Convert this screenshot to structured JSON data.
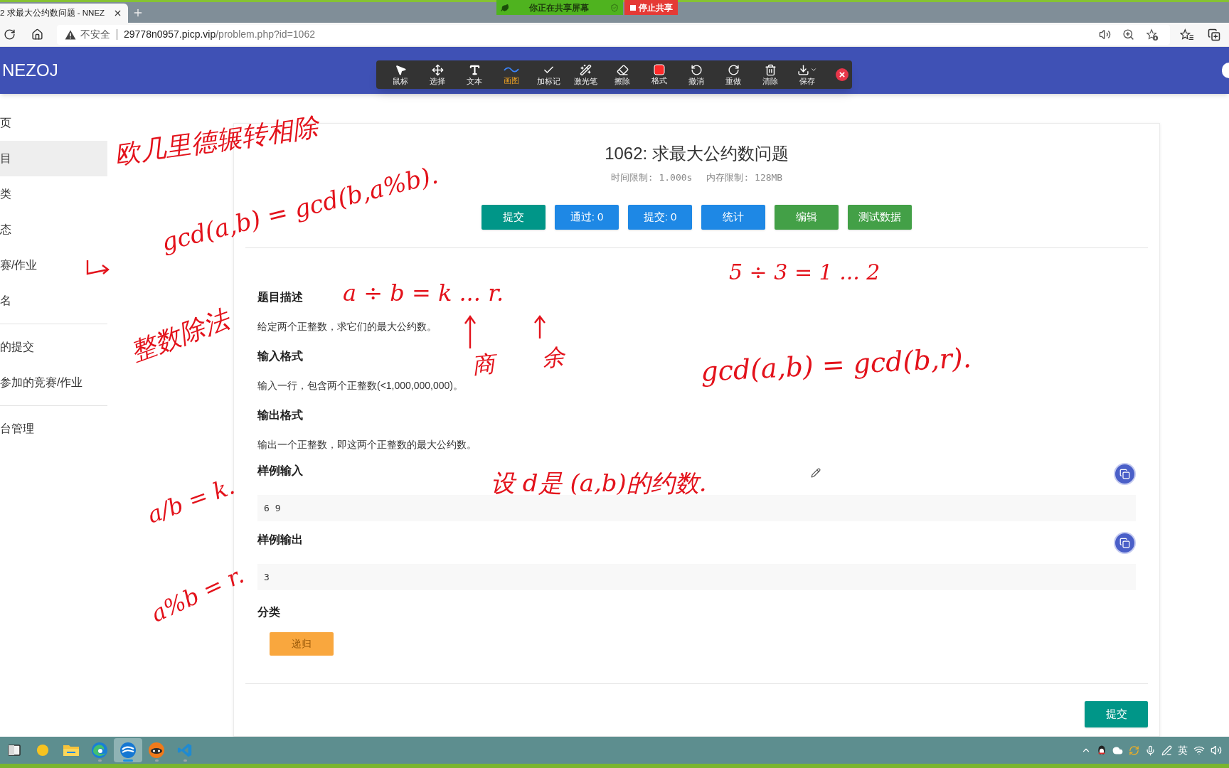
{
  "browser": {
    "tab_title": "2 求最大公约数问题 - NNEZ",
    "share_banner": {
      "status": "你正在共享屏幕",
      "stop": "停止共享"
    },
    "address": {
      "security": "不安全",
      "host": "29778n0957.picp.vip",
      "path": "/problem.php?id=1062"
    }
  },
  "navbar": {
    "brand": "NEZOJ"
  },
  "draw_toolbar": {
    "tools": [
      {
        "kind": "pointer",
        "label": "鼠标",
        "selected": false
      },
      {
        "kind": "move",
        "label": "选择",
        "selected": false
      },
      {
        "kind": "text",
        "label": "文本",
        "selected": false
      },
      {
        "kind": "pen",
        "label": "画图",
        "selected": true
      },
      {
        "kind": "mark",
        "label": "加标记",
        "selected": false
      },
      {
        "kind": "laser",
        "label": "激光笔",
        "selected": false
      },
      {
        "kind": "eraser",
        "label": "擦除",
        "selected": false
      },
      {
        "kind": "format",
        "label": "格式",
        "selected": false
      },
      {
        "kind": "undo",
        "label": "撤消",
        "selected": false
      },
      {
        "kind": "redo",
        "label": "重做",
        "selected": false
      },
      {
        "kind": "clear",
        "label": "清除",
        "selected": false
      },
      {
        "kind": "save",
        "label": "保存",
        "selected": false
      }
    ]
  },
  "sidebar": {
    "groups": [
      [
        {
          "label": "页",
          "selected": false
        },
        {
          "label": "目",
          "selected": true
        },
        {
          "label": "类",
          "selected": false
        },
        {
          "label": "态",
          "selected": false
        },
        {
          "label": "赛/作业",
          "selected": false
        },
        {
          "label": "名",
          "selected": false
        }
      ],
      [
        {
          "label": "的提交",
          "selected": false
        },
        {
          "label": "参加的竞赛/作业",
          "selected": false
        }
      ],
      [
        {
          "label": "台管理",
          "selected": false
        }
      ]
    ]
  },
  "problem": {
    "title": "1062: 求最大公约数问题",
    "limits": [
      "时间限制: 1.000s",
      "内存限制: 128MB"
    ],
    "actions": [
      {
        "label": "提交",
        "color": "#009688"
      },
      {
        "label": "通过: 0",
        "color": "#1e88e5"
      },
      {
        "label": "提交: 0",
        "color": "#1e88e5"
      },
      {
        "label": "统计",
        "color": "#1e88e5"
      },
      {
        "label": "编辑",
        "color": "#43a047"
      },
      {
        "label": "测试数据",
        "color": "#43a047"
      }
    ],
    "sections": [
      {
        "kind": "text",
        "heading": "题目描述",
        "body": "给定两个正整数，求它们的最大公约数。"
      },
      {
        "kind": "text",
        "heading": "输入格式",
        "body": "输入一行，包含两个正整数(<1,000,000,000)。"
      },
      {
        "kind": "text",
        "heading": "输出格式",
        "body": "输出一个正整数，即这两个正整数的最大公约数。"
      },
      {
        "kind": "sample",
        "heading": "样例输入",
        "value": "6 9"
      },
      {
        "kind": "sample",
        "heading": "样例输出",
        "value": "3"
      },
      {
        "kind": "tags",
        "heading": "分类",
        "tags": [
          {
            "label": "递归",
            "color": "#f9a73e"
          }
        ]
      }
    ],
    "submit": "提交"
  },
  "annotations": [
    {
      "text": "欧几里德辗转相除"
    },
    {
      "text": "gcd(a,b) = gcd(b,a%b)."
    },
    {
      "text": "整数除法"
    },
    {
      "text": "a ÷ b = k ... r."
    },
    {
      "text": "商"
    },
    {
      "text": "余"
    },
    {
      "text": "5 ÷ 3 = 1 ... 2"
    },
    {
      "text": "gcd(a,b) = gcd(b,r)."
    },
    {
      "text": "设 d是 (a,b)的约数."
    },
    {
      "text": "a/b = k."
    },
    {
      "text": "a%b = r."
    }
  ],
  "taskbar": {
    "apps": [
      {
        "kind": "desktop",
        "selected": false,
        "running": false
      },
      {
        "kind": "disc",
        "selected": false,
        "running": false
      },
      {
        "kind": "folder",
        "selected": false,
        "running": false
      },
      {
        "kind": "edge",
        "selected": false,
        "running": true
      },
      {
        "kind": "browser",
        "selected": true,
        "running": true
      },
      {
        "kind": "fox",
        "selected": false,
        "running": true
      },
      {
        "kind": "code",
        "selected": false,
        "running": true
      }
    ],
    "input_method": "英"
  }
}
